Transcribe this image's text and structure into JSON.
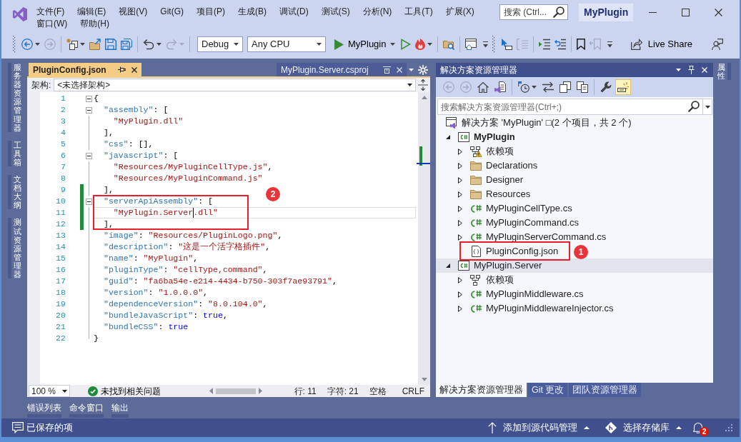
{
  "title_bar": {
    "menu": [
      "文件(F)",
      "编辑(E)",
      "视图(V)",
      "Git(G)",
      "项目(P)",
      "生成(B)",
      "调试(D)",
      "测试(S)",
      "分析(N)",
      "工具(T)",
      "扩展(X)",
      "窗口(W)",
      "帮助(H)"
    ],
    "search": {
      "placeholder": "搜索 (Ctrl..."
    },
    "title": "MyPlugin"
  },
  "toolbar": [
    {
      "kind": "grip"
    },
    {
      "kind": "back",
      "disabled": false,
      "dropdown": true
    },
    {
      "kind": "forward",
      "disabled": true
    },
    {
      "kind": "separator"
    },
    {
      "kind": "new-item",
      "disabled": false,
      "dropdown": true
    },
    {
      "kind": "open",
      "disabled": false
    },
    {
      "kind": "save",
      "disabled": false
    },
    {
      "kind": "save-all",
      "disabled": false
    },
    {
      "kind": "separator"
    },
    {
      "kind": "undo",
      "disabled": false,
      "dropdown": true
    },
    {
      "kind": "redo",
      "disabled": true,
      "dropdown": true
    },
    {
      "kind": "separator"
    },
    {
      "kind": "configuration",
      "value": "Debug"
    },
    {
      "kind": "platform",
      "value": "Any CPU"
    },
    {
      "kind": "start",
      "label": "MyPlugin"
    },
    {
      "kind": "start-without-debugging",
      "disabled": false
    },
    {
      "kind": "hot-reload",
      "disabled": false,
      "dropdown": true
    },
    {
      "kind": "separator"
    },
    {
      "kind": "find-in-folder",
      "disabled": false
    },
    {
      "kind": "separator"
    },
    {
      "kind": "window-layout",
      "disabled": false
    },
    {
      "kind": "overflow"
    },
    {
      "kind": "grip"
    },
    {
      "kind": "select-element",
      "disabled": false
    },
    {
      "kind": "comment-block",
      "disabled": true
    },
    {
      "kind": "separator"
    },
    {
      "kind": "indent",
      "disabled": false
    },
    {
      "kind": "outdent",
      "disabled": false
    },
    {
      "kind": "separator"
    },
    {
      "kind": "bookmark",
      "disabled": false
    },
    {
      "kind": "bookmark-previous",
      "disabled": true
    },
    {
      "kind": "overflow"
    },
    {
      "kind": "live-share",
      "label": "Live Share"
    },
    {
      "kind": "feedback",
      "disabled": false
    }
  ],
  "side_tabs_left": [
    "服务器资源管理器",
    "工具箱",
    "文档大纲",
    "测试资源管理器"
  ],
  "editor": {
    "tabs": [
      {
        "label": "PluginConfig.json",
        "kind": "document",
        "selected": true
      },
      {
        "label": "MyPlugin.Server.csproj",
        "kind": "preview",
        "selected": false
      }
    ],
    "navigation": {
      "label": "架构:",
      "value": "<未选择架构>"
    },
    "lines": [
      {
        "number": "1",
        "tokens": [
          {
            "kind": "punct",
            "text": "{"
          }
        ],
        "fold": true,
        "changed": false,
        "current": false
      },
      {
        "number": "2",
        "tokens": [
          {
            "kind": "key",
            "text": "  \"assembly\""
          },
          {
            "kind": "punct",
            "text": ": ["
          }
        ],
        "fold": true,
        "changed": false,
        "current": false
      },
      {
        "number": "3",
        "tokens": [
          {
            "kind": "string",
            "text": "    \"MyPlugin.dll\""
          }
        ],
        "fold": false,
        "changed": false,
        "current": false
      },
      {
        "number": "4",
        "tokens": [
          {
            "kind": "punct",
            "text": "  ],"
          }
        ],
        "fold": false,
        "changed": false,
        "current": false
      },
      {
        "number": "5",
        "tokens": [
          {
            "kind": "key",
            "text": "  \"css\""
          },
          {
            "kind": "punct",
            "text": ": [],"
          }
        ],
        "fold": false,
        "changed": false,
        "current": false
      },
      {
        "number": "6",
        "tokens": [
          {
            "kind": "key",
            "text": "  \"javascript\""
          },
          {
            "kind": "punct",
            "text": ": ["
          }
        ],
        "fold": true,
        "changed": false,
        "current": false
      },
      {
        "number": "7",
        "tokens": [
          {
            "kind": "string",
            "text": "    \"Resources/MyPluginCellType.js\""
          },
          {
            "kind": "punct",
            "text": ","
          }
        ],
        "fold": false,
        "changed": false,
        "current": false
      },
      {
        "number": "8",
        "tokens": [
          {
            "kind": "string",
            "text": "    \"Resources/MyPluginCommand.js\""
          }
        ],
        "fold": false,
        "changed": false,
        "current": false
      },
      {
        "number": "9",
        "tokens": [
          {
            "kind": "punct",
            "text": "  ],"
          }
        ],
        "fold": false,
        "changed": true,
        "current": false
      },
      {
        "number": "10",
        "tokens": [
          {
            "kind": "key",
            "text": "  \"serverApiAssembly\""
          },
          {
            "kind": "punct",
            "text": ": ["
          }
        ],
        "fold": true,
        "changed": true,
        "current": false,
        "callout": "2"
      },
      {
        "number": "11",
        "tokens": [
          {
            "kind": "string",
            "text": "    \"MyPlugin.Server"
          },
          {
            "kind": "caret"
          },
          {
            "kind": "string",
            "text": ".dll\""
          }
        ],
        "fold": false,
        "changed": true,
        "current": true
      },
      {
        "number": "12",
        "tokens": [
          {
            "kind": "punct",
            "text": "  ],"
          }
        ],
        "fold": false,
        "changed": true,
        "current": false
      },
      {
        "number": "13",
        "tokens": [
          {
            "kind": "key",
            "text": "  \"image\""
          },
          {
            "kind": "punct",
            "text": ": "
          },
          {
            "kind": "string",
            "text": "\"Resources/PluginLogo.png\""
          },
          {
            "kind": "punct",
            "text": ","
          }
        ],
        "fold": false,
        "changed": false,
        "current": false
      },
      {
        "number": "14",
        "tokens": [
          {
            "kind": "key",
            "text": "  \"description\""
          },
          {
            "kind": "punct",
            "text": ": "
          },
          {
            "kind": "string",
            "text": "\"这是一个活字格插件\""
          },
          {
            "kind": "punct",
            "text": ","
          }
        ],
        "fold": false,
        "changed": false,
        "current": false
      },
      {
        "number": "15",
        "tokens": [
          {
            "kind": "key",
            "text": "  \"name\""
          },
          {
            "kind": "punct",
            "text": ": "
          },
          {
            "kind": "string",
            "text": "\"MyPlugin\""
          },
          {
            "kind": "punct",
            "text": ","
          }
        ],
        "fold": false,
        "changed": false,
        "current": false
      },
      {
        "number": "16",
        "tokens": [
          {
            "kind": "key",
            "text": "  \"pluginType\""
          },
          {
            "kind": "punct",
            "text": ": "
          },
          {
            "kind": "string",
            "text": "\"cellType,command\""
          },
          {
            "kind": "punct",
            "text": ","
          }
        ],
        "fold": false,
        "changed": false,
        "current": false
      },
      {
        "number": "17",
        "tokens": [
          {
            "kind": "key",
            "text": "  \"guid\""
          },
          {
            "kind": "punct",
            "text": ": "
          },
          {
            "kind": "string",
            "text": "\"fa6ba54e-e214-4434-b750-303f7ae93791\""
          },
          {
            "kind": "punct",
            "text": ","
          }
        ],
        "fold": false,
        "changed": false,
        "current": false
      },
      {
        "number": "18",
        "tokens": [
          {
            "kind": "key",
            "text": "  \"version\""
          },
          {
            "kind": "punct",
            "text": ": "
          },
          {
            "kind": "string",
            "text": "\"1.0.0.0\""
          },
          {
            "kind": "punct",
            "text": ","
          }
        ],
        "fold": false,
        "changed": false,
        "current": false
      },
      {
        "number": "19",
        "tokens": [
          {
            "kind": "key",
            "text": "  \"dependenceVersion\""
          },
          {
            "kind": "punct",
            "text": ": "
          },
          {
            "kind": "string",
            "text": "\"8.0.104.0\""
          },
          {
            "kind": "punct",
            "text": ","
          }
        ],
        "fold": false,
        "changed": false,
        "current": false
      },
      {
        "number": "20",
        "tokens": [
          {
            "kind": "key",
            "text": "  \"bundleJavaScript\""
          },
          {
            "kind": "punct",
            "text": ": "
          },
          {
            "kind": "literal",
            "text": "true"
          },
          {
            "kind": "punct",
            "text": ","
          }
        ],
        "fold": false,
        "changed": false,
        "current": false
      },
      {
        "number": "21",
        "tokens": [
          {
            "kind": "key",
            "text": "  \"bundleCSS\""
          },
          {
            "kind": "punct",
            "text": ": "
          },
          {
            "kind": "literal",
            "text": "true"
          }
        ],
        "fold": false,
        "changed": false,
        "current": false
      },
      {
        "number": "22",
        "tokens": [
          {
            "kind": "punct",
            "text": "}"
          }
        ],
        "fold": false,
        "changed": false,
        "current": false
      }
    ],
    "status": {
      "zoom": "100 %",
      "issues": "未找到相关问题",
      "line": "行: 11",
      "column": "字符: 21",
      "indent": "空格",
      "line_ending": "CRLF"
    }
  },
  "tool_tabs_bottom": [
    "错误列表",
    "命令窗口",
    "输出"
  ],
  "solution_explorer": {
    "title": "解决方案资源管理器",
    "toolbar": [
      {
        "kind": "back",
        "disabled": true
      },
      {
        "kind": "forward",
        "disabled": true
      },
      {
        "kind": "home",
        "disabled": false
      },
      {
        "kind": "switch-views",
        "disabled": false
      },
      {
        "kind": "separator"
      },
      {
        "kind": "pending-changes",
        "disabled": false,
        "dropdown": true
      },
      {
        "kind": "sync",
        "disabled": false
      },
      {
        "kind": "collapse-all",
        "disabled": false
      },
      {
        "kind": "show-all-files",
        "disabled": false,
        "on": false
      },
      {
        "kind": "separator"
      },
      {
        "kind": "properties",
        "disabled": false
      },
      {
        "kind": "preview-selected",
        "disabled": false,
        "on": true
      }
    ],
    "search": {
      "placeholder": "搜索解决方案资源管理器(Ctrl+;)"
    },
    "tree": [
      {
        "kind": "solution",
        "label": "解决方案 'MyPlugin' □(2 个项目，共 2 个)",
        "selected": false,
        "children": [
          {
            "kind": "project",
            "label": "MyPlugin",
            "startup": true,
            "expanded": true,
            "selected": false,
            "children": [
              {
                "kind": "dependencies",
                "label": "依赖项",
                "warning": true,
                "expanded": false,
                "selected": false
              },
              {
                "kind": "folder",
                "label": "Declarations",
                "expanded": false,
                "selected": false
              },
              {
                "kind": "folder",
                "label": "Designer",
                "expanded": false,
                "selected": false
              },
              {
                "kind": "folder",
                "label": "Resources",
                "expanded": false,
                "selected": false
              },
              {
                "kind": "csharp",
                "label": "MyPluginCellType.cs",
                "expanded": false,
                "selected": false
              },
              {
                "kind": "csharp",
                "label": "MyPluginCommand.cs",
                "expanded": false,
                "selected": false
              },
              {
                "kind": "csharp",
                "label": "MyPluginServerCommand.cs",
                "expanded": false,
                "selected": false
              },
              {
                "kind": "json",
                "label": "PluginConfig.json",
                "selected": false,
                "callout": "1"
              }
            ]
          },
          {
            "kind": "project",
            "label": "MyPlugin.Server",
            "startup": false,
            "expanded": true,
            "selected": true,
            "children": [
              {
                "kind": "dependencies",
                "label": "依赖项",
                "warning": false,
                "expanded": false,
                "selected": false
              },
              {
                "kind": "csharp",
                "label": "MyPluginMiddleware.cs",
                "expanded": false,
                "selected": false
              },
              {
                "kind": "csharp",
                "label": "MyPluginMiddlewareInjector.cs",
                "expanded": false,
                "selected": false
              }
            ]
          }
        ]
      }
    ],
    "tabs": [
      {
        "label": "解决方案资源管理器",
        "selected": true
      },
      {
        "label": "Git 更改",
        "selected": false
      },
      {
        "label": "团队资源管理器",
        "selected": false
      }
    ]
  },
  "side_tabs_right": [
    "属性"
  ],
  "status_bar": {
    "message": "已保存的项",
    "source_control": "添加到源代码管理",
    "repository": "选择存储库",
    "notifications": "2"
  }
}
